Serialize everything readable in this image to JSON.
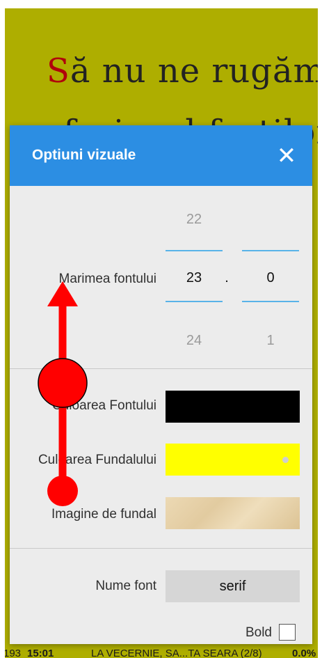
{
  "reader": {
    "dropcap": "S",
    "line1_rest": "ă nu ne rugăm",
    "line2": "ca fariseul fratilor",
    "status": {
      "page": "193",
      "time": "15:01",
      "chapter": "LA VECERNIE, SA...TA SEARA (2/8)",
      "percent": "0.0%"
    }
  },
  "dialog": {
    "title": "Optiuni vizuale",
    "close_icon": "✕",
    "font_size": {
      "label": "Marimea fontului",
      "prev_int": "22",
      "current_int": "23",
      "next_int": "24",
      "separator": ".",
      "current_dec": "0",
      "next_dec": "1"
    },
    "font_color": {
      "label": "Culoarea Fontului",
      "value": "#000000"
    },
    "background_color": {
      "label": "Culoarea Fundalului",
      "value": "#ffff00"
    },
    "background_image": {
      "label": "Imagine de fundal"
    },
    "font_name": {
      "label": "Nume font",
      "value": "serif"
    },
    "bold": {
      "label": "Bold",
      "checked": false
    }
  },
  "colors": {
    "reader_bg": "#aeae00",
    "header": "#2c8ee3",
    "dialog_bg": "#ececec",
    "gesture": "#ff0000"
  }
}
